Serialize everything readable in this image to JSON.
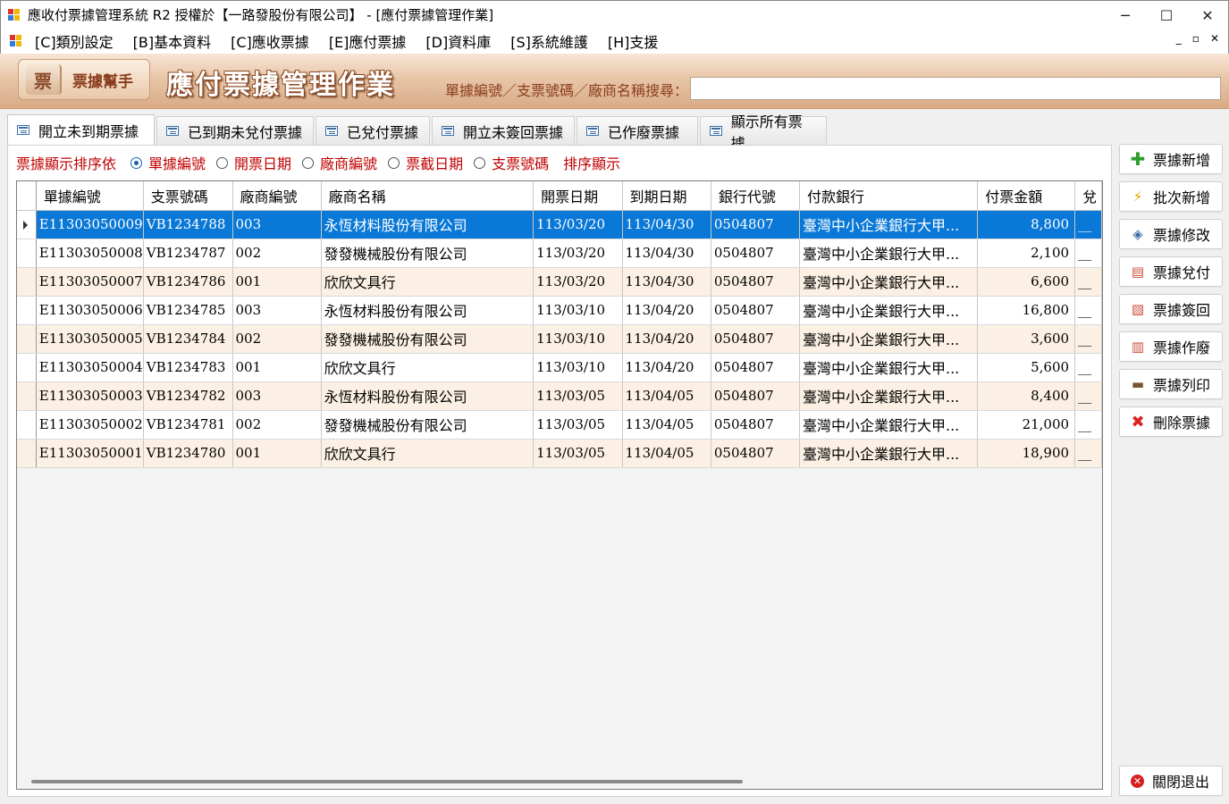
{
  "window": {
    "title": "應收付票據管理系統 R2 授權於【一路發股份有限公司】 - [應付票據管理作業]",
    "minimize": "─",
    "maximize": "☐",
    "close": "✕"
  },
  "menu": {
    "items": [
      "[C]類別設定",
      "[B]基本資料",
      "[C]應收票據",
      "[E]應付票據",
      "[D]資料庫",
      "[S]系統維護",
      "[H]支援"
    ],
    "mdi_min": "_",
    "mdi_restore": "▫",
    "mdi_close": "✕"
  },
  "header": {
    "logo_glyph": "票",
    "logo_text": "票據幫手",
    "title": "應付票據管理作業",
    "search_label": "單據編號／支票號碼／廠商名稱搜尋：",
    "search_value": ""
  },
  "tabs": [
    "開立未到期票據",
    "已到期未兌付票據",
    "已兌付票據",
    "開立未簽回票據",
    "已作廢票據",
    "顯示所有票據"
  ],
  "active_tab": 0,
  "sort": {
    "label": "票據顯示排序依",
    "options": [
      "單據編號",
      "開票日期",
      "廠商編號",
      "票截日期",
      "支票號碼"
    ],
    "selected": 0,
    "button": "排序顯示"
  },
  "table": {
    "columns": [
      "單據編號",
      "支票號碼",
      "廠商編號",
      "廠商名稱",
      "開票日期",
      "到期日期",
      "銀行代號",
      "付款銀行",
      "付票金額",
      "兌"
    ],
    "rows": [
      [
        "E11303050009",
        "VB1234788",
        "003",
        "永恆材料股份有限公司",
        "113/03/20",
        "113/04/30",
        "0504807",
        "臺灣中小企業銀行大甲...",
        "8,800",
        "__"
      ],
      [
        "E11303050008",
        "VB1234787",
        "002",
        "發發機械股份有限公司",
        "113/03/20",
        "113/04/30",
        "0504807",
        "臺灣中小企業銀行大甲...",
        "2,100",
        "__"
      ],
      [
        "E11303050007",
        "VB1234786",
        "001",
        "欣欣文具行",
        "113/03/20",
        "113/04/30",
        "0504807",
        "臺灣中小企業銀行大甲...",
        "6,600",
        "__"
      ],
      [
        "E11303050006",
        "VB1234785",
        "003",
        "永恆材料股份有限公司",
        "113/03/10",
        "113/04/20",
        "0504807",
        "臺灣中小企業銀行大甲...",
        "16,800",
        "__"
      ],
      [
        "E11303050005",
        "VB1234784",
        "002",
        "發發機械股份有限公司",
        "113/03/10",
        "113/04/20",
        "0504807",
        "臺灣中小企業銀行大甲...",
        "3,600",
        "__"
      ],
      [
        "E11303050004",
        "VB1234783",
        "001",
        "欣欣文具行",
        "113/03/10",
        "113/04/20",
        "0504807",
        "臺灣中小企業銀行大甲...",
        "5,600",
        "__"
      ],
      [
        "E11303050003",
        "VB1234782",
        "003",
        "永恆材料股份有限公司",
        "113/03/05",
        "113/04/05",
        "0504807",
        "臺灣中小企業銀行大甲...",
        "8,400",
        "__"
      ],
      [
        "E11303050002",
        "VB1234781",
        "002",
        "發發機械股份有限公司",
        "113/03/05",
        "113/04/05",
        "0504807",
        "臺灣中小企業銀行大甲...",
        "21,000",
        "__"
      ],
      [
        "E11303050001",
        "VB1234780",
        "001",
        "欣欣文具行",
        "113/03/05",
        "113/04/05",
        "0504807",
        "臺灣中小企業銀行大甲...",
        "18,900",
        "__"
      ]
    ],
    "selected_row": 0
  },
  "side_buttons": [
    {
      "label": "票據新增",
      "icon": "plus-icon"
    },
    {
      "label": "批次新增",
      "icon": "bolt-icon"
    },
    {
      "label": "票據修改",
      "icon": "eraser-icon"
    },
    {
      "label": "票據兌付",
      "icon": "document-arrow-icon"
    },
    {
      "label": "票據簽回",
      "icon": "document-sign-icon"
    },
    {
      "label": "票據作廢",
      "icon": "document-void-icon"
    },
    {
      "label": "票據列印",
      "icon": "printer-icon"
    },
    {
      "label": "刪除票據",
      "icon": "delete-x-icon"
    }
  ],
  "close_button": {
    "label": "關閉退出",
    "icon": "close-circle-icon"
  },
  "colors": {
    "selection": "#0a78d7",
    "alt_row": "#fbf0e3",
    "sort_text": "#c00000",
    "header_brown": "#8b3d1e"
  }
}
